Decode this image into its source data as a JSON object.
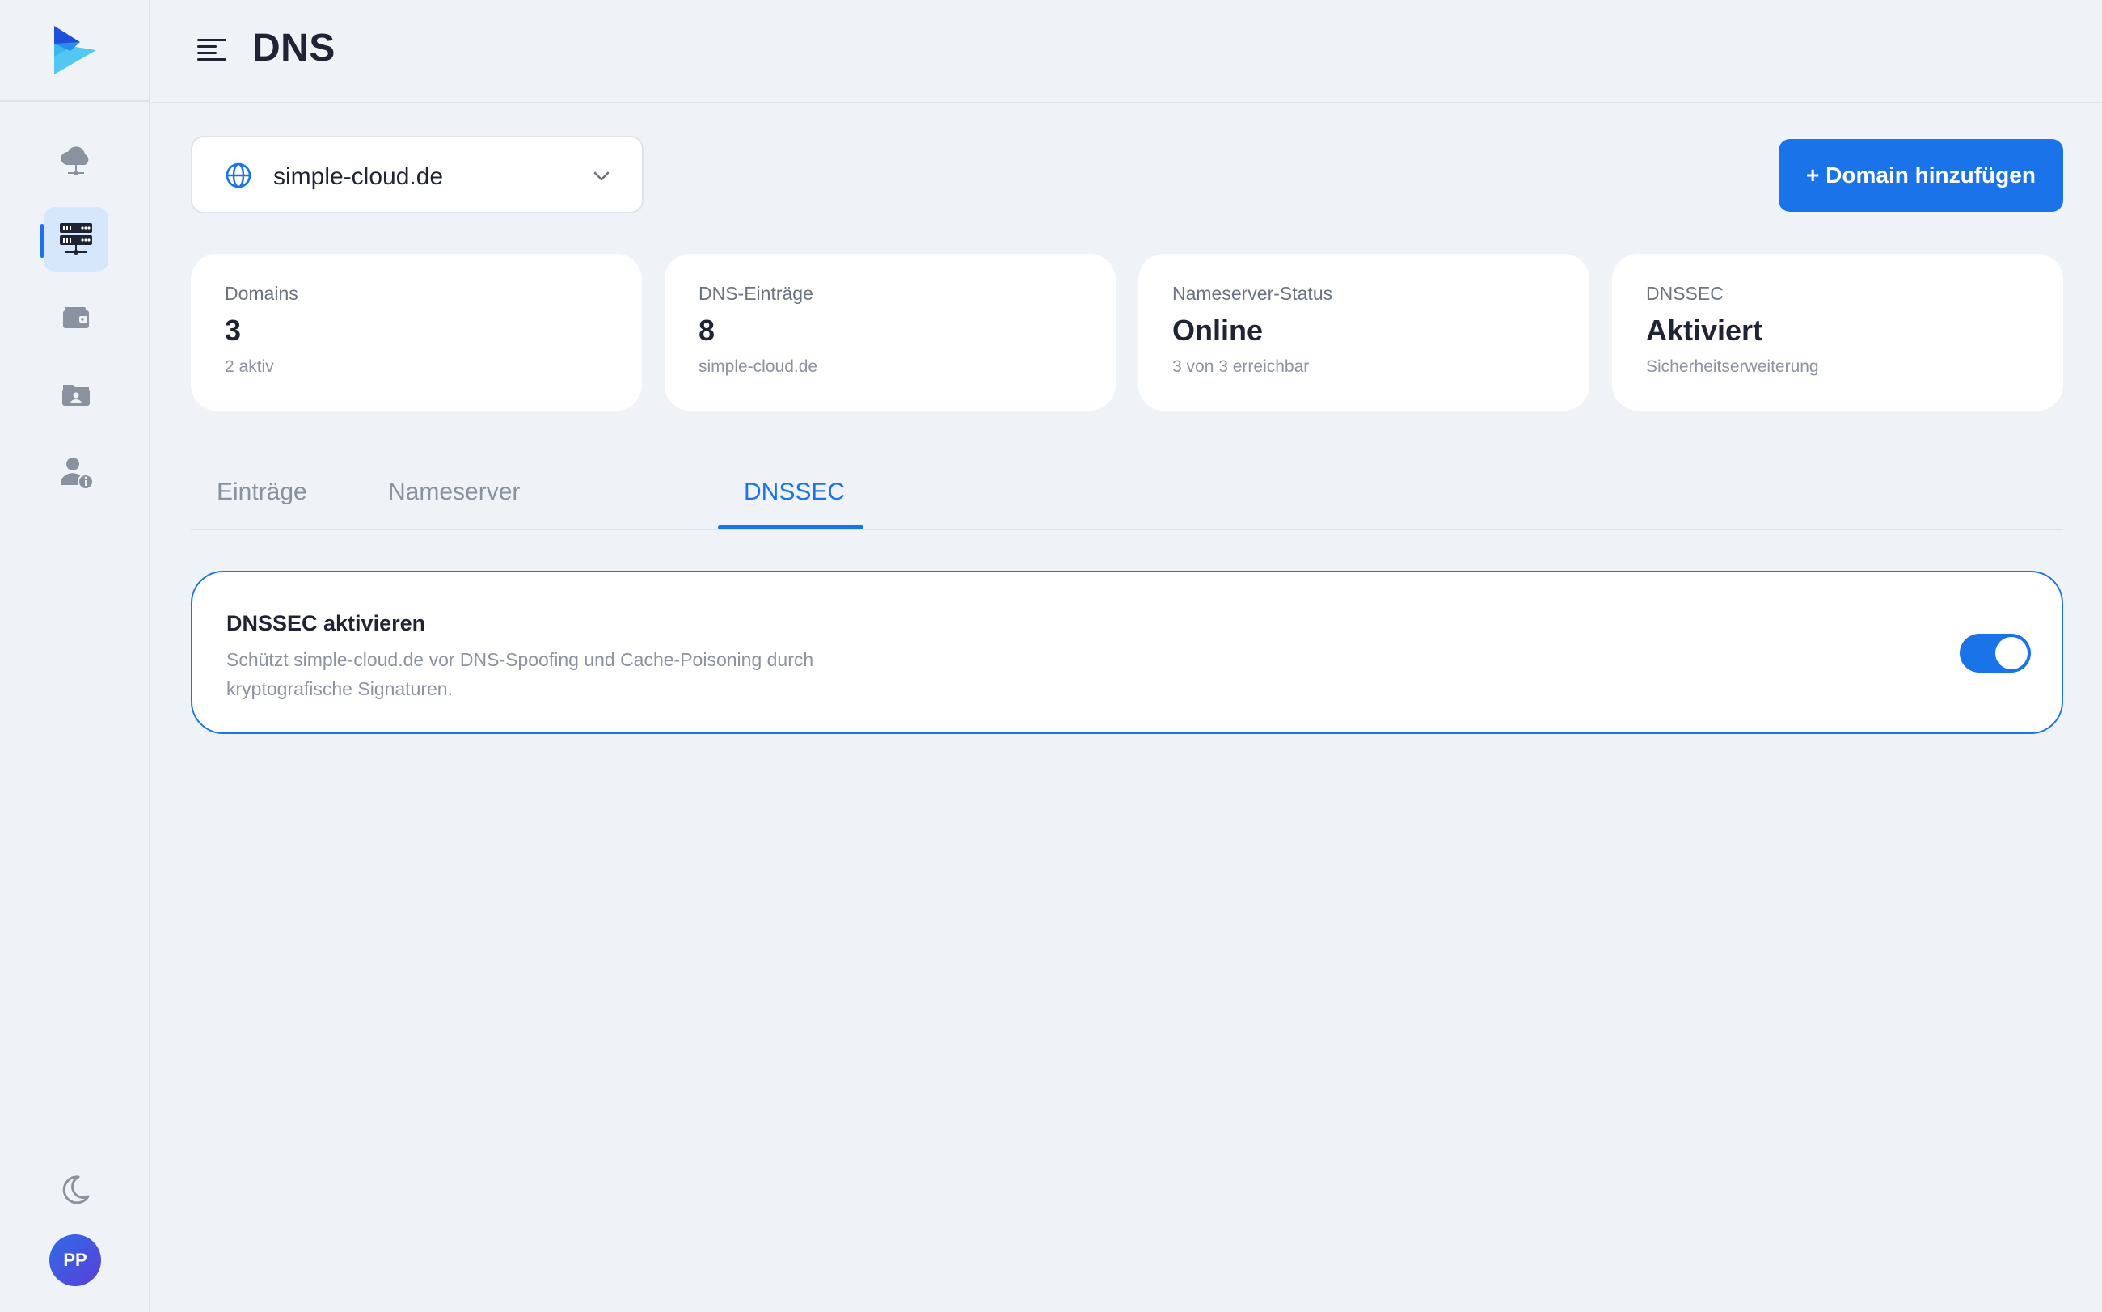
{
  "header": {
    "title": "DNS"
  },
  "sidebar": {
    "items": [
      {
        "icon": "cloud-icon"
      },
      {
        "icon": "server-network-icon",
        "active": true
      },
      {
        "icon": "wallet-icon"
      },
      {
        "icon": "contact-folder-icon"
      },
      {
        "icon": "user-info-icon"
      }
    ],
    "avatar_initials": "PP"
  },
  "domain_select": {
    "value": "simple-cloud.de"
  },
  "add_domain_button": {
    "label": "+ Domain hinzufügen"
  },
  "stats": [
    {
      "label": "Domains",
      "value": "3",
      "sub": "2 aktiv"
    },
    {
      "label": "DNS-Einträge",
      "value": "8",
      "sub": "simple-cloud.de"
    },
    {
      "label": "Nameserver-Status",
      "value": "Online",
      "sub": "3 von 3 erreichbar"
    },
    {
      "label": "DNSSEC",
      "value": "Aktiviert",
      "sub": "Sicherheitserweiterung"
    }
  ],
  "tabs": [
    {
      "label": "Einträge"
    },
    {
      "label": "Nameserver"
    },
    {
      "label": "DNSSEC",
      "active": true
    }
  ],
  "dnssec_panel": {
    "title": "DNSSEC aktivieren",
    "description": "Schützt simple-cloud.de vor DNS-Spoofing und Cache-Poisoning durch kryptografische Signaturen.",
    "enabled": true
  },
  "colors": {
    "accent": "#1a73e8",
    "background": "#eff3f8",
    "card": "#ffffff"
  }
}
